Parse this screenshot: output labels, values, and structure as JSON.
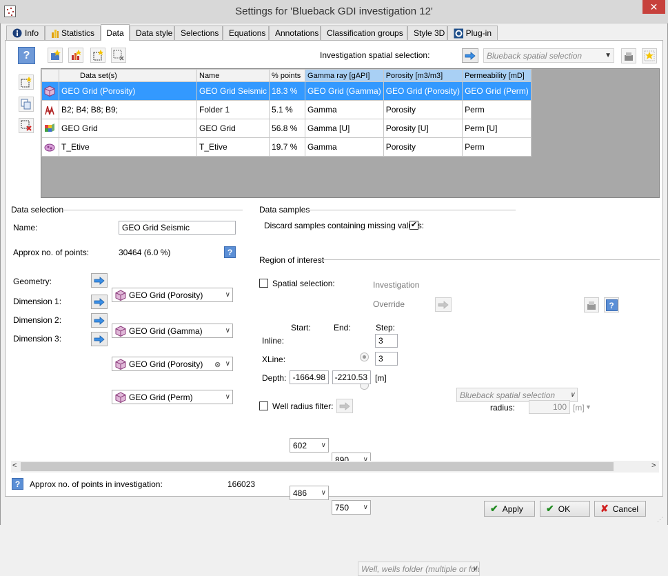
{
  "window": {
    "title": "Settings for 'Blueback GDI investigation 12'",
    "close_glyph": "✕"
  },
  "tabs": [
    {
      "label": "Info",
      "icon": "info-icon"
    },
    {
      "label": "Statistics",
      "icon": "statistics-icon"
    },
    {
      "label": "Data",
      "icon": ""
    },
    {
      "label": "Data style",
      "icon": ""
    },
    {
      "label": "Selections",
      "icon": ""
    },
    {
      "label": "Equations",
      "icon": ""
    },
    {
      "label": "Annotations",
      "icon": ""
    },
    {
      "label": "Classification groups",
      "icon": ""
    },
    {
      "label": "Style 3D",
      "icon": ""
    },
    {
      "label": "Plug-in",
      "icon": "plugin-icon"
    }
  ],
  "toolbar": {
    "spatial_label": "Investigation spatial selection:",
    "spatial_placeholder": "Blueback spatial selection"
  },
  "datasets": {
    "headers": [
      "",
      "Data set(s)",
      "Name",
      "% points",
      "Gamma ray [gAPI]",
      "Porosity [m3/m3]",
      "Permeability [mD]"
    ],
    "rows": [
      {
        "icon": "grid-cube-icon",
        "dataset": "GEO Grid (Porosity)",
        "name": "GEO Grid Seismic",
        "points": "18.3 %",
        "gamma": "GEO Grid (Gamma)",
        "porosity": "GEO Grid (Porosity)",
        "perm": "GEO Grid (Perm)",
        "selected": true
      },
      {
        "icon": "well-folder-icon",
        "dataset": "B2; B4; B8; B9;",
        "name": "Folder 1",
        "points": "5.1 %",
        "gamma": "Gamma",
        "porosity": "Porosity",
        "perm": "Perm",
        "selected": false
      },
      {
        "icon": "grid-3d-icon",
        "dataset": "GEO Grid",
        "name": "GEO Grid",
        "points": "56.8 %",
        "gamma": "Gamma [U]",
        "porosity": "Porosity [U]",
        "perm": "Perm [U]",
        "selected": false
      },
      {
        "icon": "point-set-icon",
        "dataset": "T_Etive",
        "name": "T_Etive",
        "points": "19.7 %",
        "gamma": "Gamma",
        "porosity": "Porosity",
        "perm": "Perm",
        "selected": false
      }
    ]
  },
  "data_selection": {
    "section_label": "Data selection",
    "name_label": "Name:",
    "name_value": "GEO Grid Seismic",
    "approx_label": "Approx no. of points:",
    "approx_value": "30464 (6.0 %)",
    "geometry_label": "Geometry:",
    "geometry_value": "GEO Grid (Porosity)",
    "dim1_label": "Dimension 1:",
    "dim1_value": "GEO Grid (Gamma)",
    "dim2_label": "Dimension 2:",
    "dim2_value": "GEO Grid (Porosity)",
    "dim3_label": "Dimension 3:",
    "dim3_value": "GEO Grid (Perm)"
  },
  "data_samples": {
    "section_label": "Data samples",
    "discard_label": "Discard samples containing missing values:",
    "discard_checked": "✔"
  },
  "region": {
    "section_label": "Region of interest",
    "spatial_label": "Spatial selection:",
    "investigation_label": "Investigation",
    "override_label": "Override",
    "override_placeholder": "Blueback spatial selection",
    "start_label": "Start:",
    "end_label": "End:",
    "step_label": "Step:",
    "inline_label": "Inline:",
    "inline_start": "602",
    "inline_end": "890",
    "inline_step": "3",
    "xline_label": "XLine:",
    "xline_start": "486",
    "xline_end": "750",
    "xline_step": "3",
    "depth_label": "Depth:",
    "depth_start": "-1664.98",
    "depth_end": "-2210.53",
    "depth_unit": "[m]",
    "well_label": "Well radius filter:",
    "well_placeholder": "Well, wells folder (multiple or fold",
    "radius_label": "radius:",
    "radius_value": "100",
    "radius_unit": "[m]"
  },
  "footer": {
    "approx_label": "Approx no. of points in investigation:",
    "approx_value": "166023",
    "apply_label": "Apply",
    "ok_label": "OK",
    "cancel_label": "Cancel"
  }
}
